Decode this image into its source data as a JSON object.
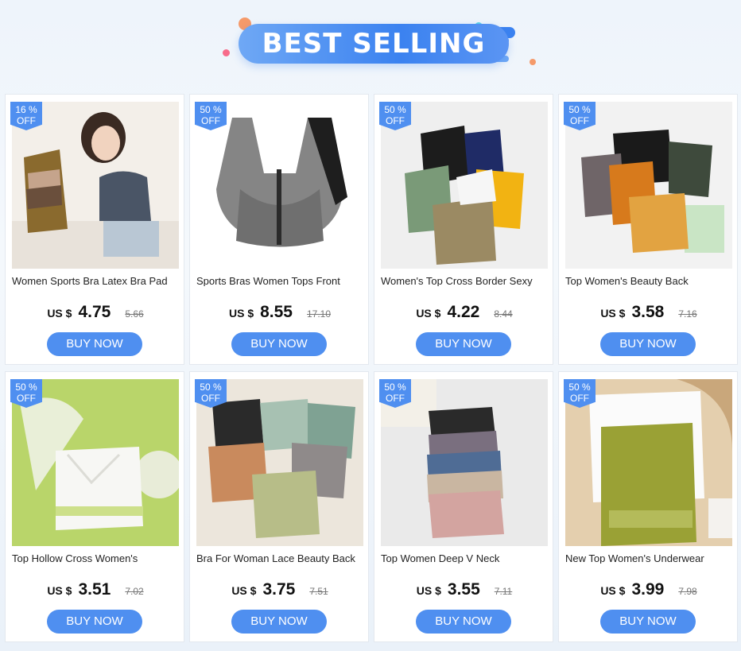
{
  "banner": {
    "title": "BEST SELLING"
  },
  "colors": {
    "accent": "#4f8ff0",
    "banner": "#3b82f0"
  },
  "products": [
    {
      "badge_pct": "16 %",
      "badge_off": "OFF",
      "title": "Women Sports Bra Latex Bra Pad",
      "currency": "US $",
      "price": "4.75",
      "old_price": "5.66",
      "button": "BUY NOW"
    },
    {
      "badge_pct": "50 %",
      "badge_off": "OFF",
      "title": "Sports Bras Women Tops Front",
      "currency": "US $",
      "price": "8.55",
      "old_price": "17.10",
      "button": "BUY NOW"
    },
    {
      "badge_pct": "50 %",
      "badge_off": "OFF",
      "title": "Women's Top Cross Border Sexy",
      "currency": "US $",
      "price": "4.22",
      "old_price": "8.44",
      "button": "BUY NOW"
    },
    {
      "badge_pct": "50 %",
      "badge_off": "OFF",
      "title": "Top Women's Beauty Back",
      "currency": "US $",
      "price": "3.58",
      "old_price": "7.16",
      "button": "BUY NOW"
    },
    {
      "badge_pct": "50 %",
      "badge_off": "OFF",
      "title": "Top Hollow Cross Women's",
      "currency": "US $",
      "price": "3.51",
      "old_price": "7.02",
      "button": "BUY NOW"
    },
    {
      "badge_pct": "50 %",
      "badge_off": "OFF",
      "title": "Bra For Woman Lace Beauty Back",
      "currency": "US $",
      "price": "3.75",
      "old_price": "7.51",
      "button": "BUY NOW"
    },
    {
      "badge_pct": "50 %",
      "badge_off": "OFF",
      "title": "Top Women Deep V Neck",
      "currency": "US $",
      "price": "3.55",
      "old_price": "7.11",
      "button": "BUY NOW"
    },
    {
      "badge_pct": "50 %",
      "badge_off": "OFF",
      "title": "New Top Women's Underwear",
      "currency": "US $",
      "price": "3.99",
      "old_price": "7.98",
      "button": "BUY NOW"
    }
  ]
}
